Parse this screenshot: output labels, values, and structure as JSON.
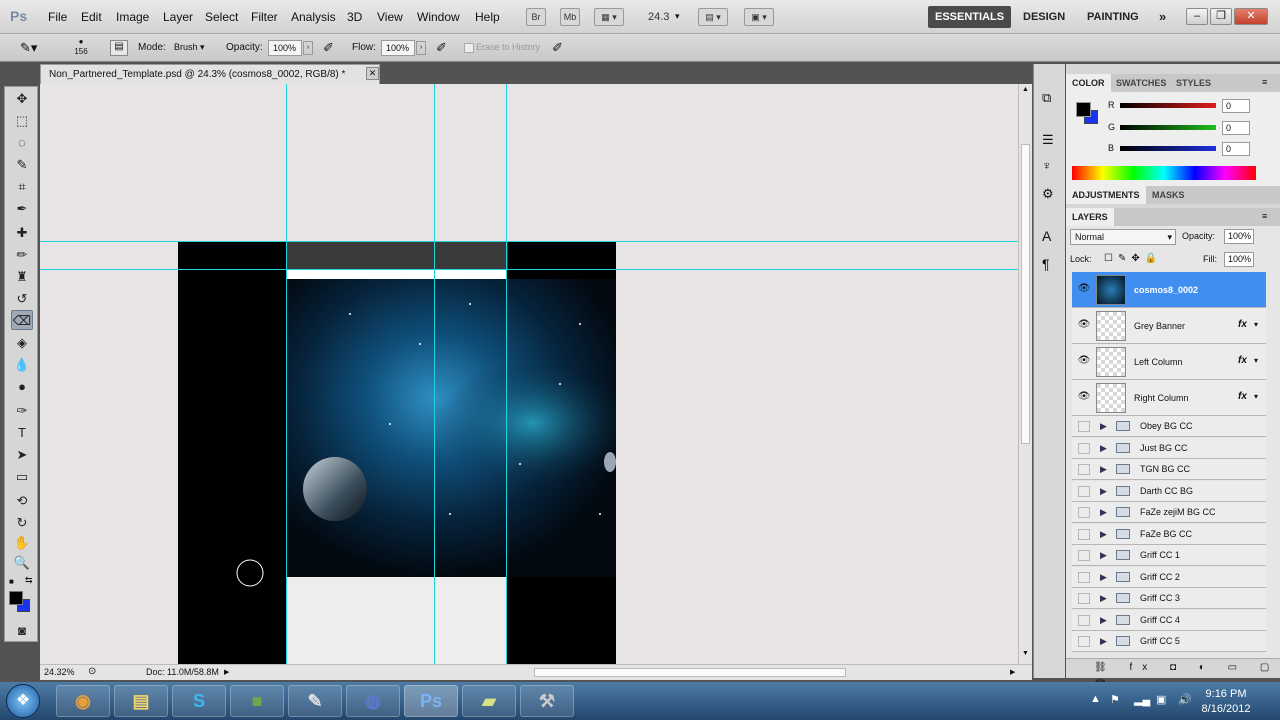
{
  "app": {
    "logo": "Ps"
  },
  "menu": [
    "File",
    "Edit",
    "Image",
    "Layer",
    "Select",
    "Filter",
    "Analysis",
    "3D",
    "View",
    "Window",
    "Help"
  ],
  "menubar_tools": {
    "bridge": "Br",
    "minibridge": "Mb",
    "zoom_value": "24.3"
  },
  "workspaces": [
    "ESSENTIALS",
    "DESIGN",
    "PAINTING"
  ],
  "options": {
    "brush_size": "156",
    "mode_label": "Mode:",
    "mode_value": "Brush",
    "opacity_label": "Opacity:",
    "opacity_value": "100%",
    "flow_label": "Flow:",
    "flow_value": "100%",
    "erase_history": "Erase to History"
  },
  "document": {
    "tab_title": "Non_Partnered_Template.psd @ 24.3% (cosmos8_0002, RGB/8) *",
    "status_zoom": "24.32%",
    "status_doc": "Doc: 11.0M/58.8M"
  },
  "color_panel": {
    "tabs": [
      "COLOR",
      "SWATCHES",
      "STYLES"
    ],
    "channels": [
      {
        "label": "R",
        "value": "0",
        "color": "#e21c1c"
      },
      {
        "label": "G",
        "value": "0",
        "color": "#1fbf1f"
      },
      {
        "label": "B",
        "value": "0",
        "color": "#1f2fe0"
      }
    ]
  },
  "adjust_tabs": [
    "ADJUSTMENTS",
    "MASKS"
  ],
  "layers_panel": {
    "tab": "LAYERS",
    "blend_mode": "Normal",
    "opacity_label": "Opacity:",
    "opacity_value": "100%",
    "lock_label": "Lock:",
    "fill_label": "Fill:",
    "fill_value": "100%",
    "layers": [
      {
        "name": "cosmos8_0002",
        "selected": true,
        "fx": false
      },
      {
        "name": "Grey Banner",
        "selected": false,
        "fx": true
      },
      {
        "name": "Left Column",
        "selected": false,
        "fx": true
      },
      {
        "name": "Right Column",
        "selected": false,
        "fx": true
      }
    ],
    "groups": [
      "Obey BG CC",
      "Just BG CC",
      "TGN BG CC",
      "Darth CC BG",
      "FaZe zejiM BG CC",
      "FaZe BG CC",
      "Griff CC 1",
      "Griff CC 2",
      "Griff CC 3",
      "Griff CC 4",
      "Griff CC 5"
    ],
    "fx_symbol": "fx"
  },
  "taskbar": {
    "apps": [
      "chrome",
      "explorer",
      "skype",
      "minecraft",
      "notepad",
      "firefox",
      "photoshop",
      "notes",
      "tool"
    ],
    "ps_label": "Ps",
    "time": "9:16 PM",
    "date": "8/16/2012"
  },
  "colors": {
    "accent_selected": "#3f8ef0",
    "guide": "#19d6dd",
    "canvas": "#e8e4e3"
  }
}
